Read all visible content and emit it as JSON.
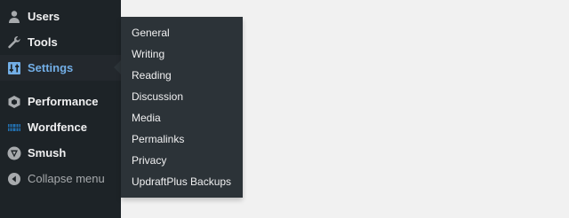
{
  "sidebar": {
    "items": [
      {
        "label": "Users",
        "icon": "users-icon"
      },
      {
        "label": "Tools",
        "icon": "wrench-icon"
      },
      {
        "label": "Settings",
        "icon": "settings-icon",
        "active": true
      },
      {
        "label": "Performance",
        "icon": "performance-icon"
      },
      {
        "label": "Wordfence",
        "icon": "wordfence-icon"
      },
      {
        "label": "Smush",
        "icon": "smush-icon"
      },
      {
        "label": "Collapse menu",
        "icon": "collapse-arrow-icon"
      }
    ]
  },
  "settings_submenu": {
    "items": [
      {
        "label": "General"
      },
      {
        "label": "Writing"
      },
      {
        "label": "Reading"
      },
      {
        "label": "Discussion"
      },
      {
        "label": "Media"
      },
      {
        "label": "Permalinks"
      },
      {
        "label": "Privacy"
      },
      {
        "label": "UpdraftPlus Backups"
      }
    ]
  },
  "colors": {
    "sidebar_bg": "#1d2327",
    "flyout_bg": "#2c3338",
    "active_text": "#72aee6",
    "page_bg": "#f1f1f1"
  }
}
